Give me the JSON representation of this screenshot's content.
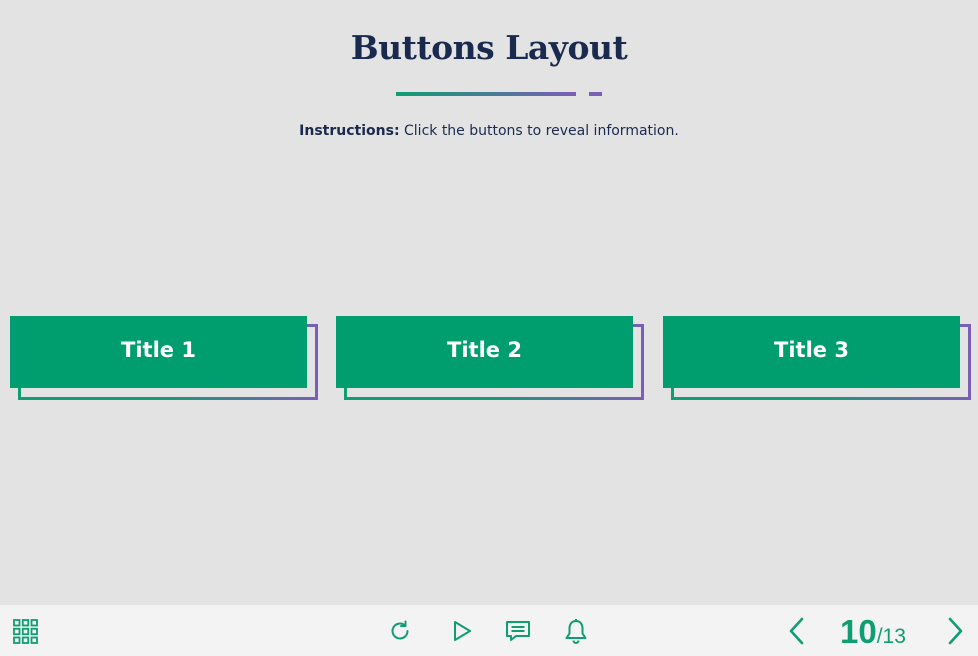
{
  "slide": {
    "title": "Buttons Layout",
    "instructions_label": "Instructions:",
    "instructions_text": " Click the buttons to reveal information."
  },
  "buttons": [
    {
      "label": "Title 1"
    },
    {
      "label": "Title 2"
    },
    {
      "label": "Title 3"
    }
  ],
  "toolbar": {
    "menu_icon": "grid-menu-icon",
    "icons": [
      "replay-icon",
      "play-icon",
      "comment-icon",
      "bell-icon"
    ],
    "page_current": "10",
    "page_total": "/13",
    "accent_color": "#0f9d72"
  },
  "colors": {
    "button_fill": "#009e6e",
    "gradient_start": "#0f9d72",
    "gradient_end": "#7b5eb6",
    "title_color": "#1a2a4f",
    "background": "#e3e3e3"
  }
}
